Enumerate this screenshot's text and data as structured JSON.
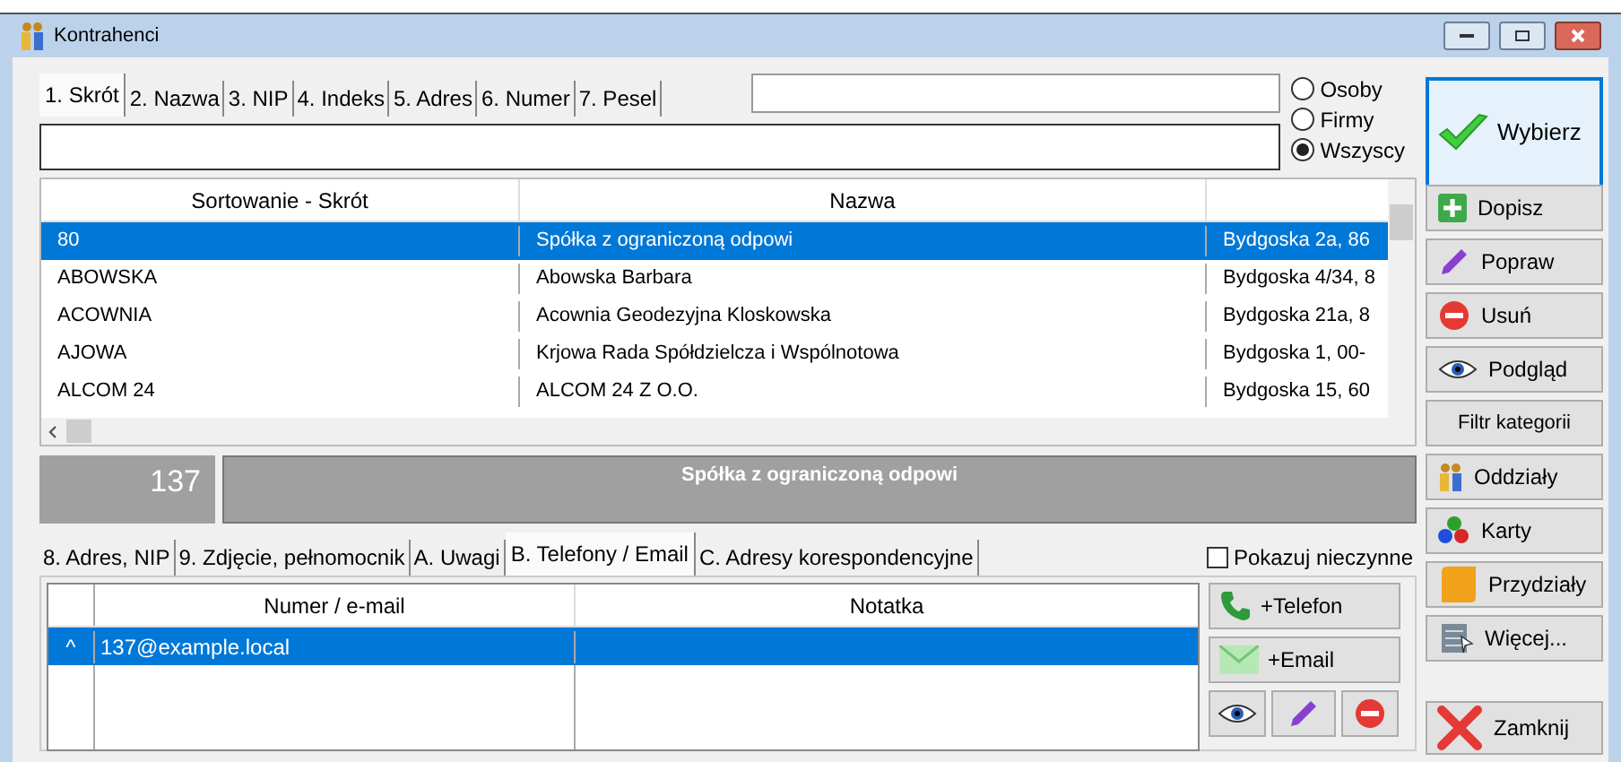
{
  "window": {
    "title": "Kontrahenci"
  },
  "search_tabs": [
    {
      "label": "1. Skrót",
      "selected": true
    },
    {
      "label": "2. Nazwa",
      "selected": false
    },
    {
      "label": "3. NIP",
      "selected": false
    },
    {
      "label": "4. Indeks",
      "selected": false
    },
    {
      "label": "5. Adres",
      "selected": false
    },
    {
      "label": "6. Numer",
      "selected": false
    },
    {
      "label": "7. Pesel",
      "selected": false
    }
  ],
  "filter": [
    {
      "label": "Osoby",
      "selected": false
    },
    {
      "label": "Firmy",
      "selected": false
    },
    {
      "label": "Wszyscy",
      "selected": true
    }
  ],
  "table": {
    "columns": [
      "Sortowanie - Skrót",
      "Nazwa"
    ],
    "rows": [
      {
        "cells": [
          "80",
          "Spółka z ograniczoną odpowi",
          "Bydgoska 2a, 86"
        ],
        "selected": true
      },
      {
        "cells": [
          "ABOWSKA",
          "Abowska Barbara",
          "Bydgoska 4/34, 8"
        ],
        "selected": false
      },
      {
        "cells": [
          "ACOWNIA",
          "Acownia Geodezyjna Kloskowska",
          "Bydgoska 21a, 8"
        ],
        "selected": false
      },
      {
        "cells": [
          "AJOWA",
          "Krjowa Rada Spółdzielcza i Wspólnotowa",
          "Bydgoska 1, 00-"
        ],
        "selected": false
      },
      {
        "cells": [
          "ALCOM 24",
          "ALCOM 24 Z O.O.",
          "Bydgoska 15, 60"
        ],
        "selected": false
      }
    ]
  },
  "details": {
    "number": "137",
    "name": "Spółka z ograniczoną odpowi"
  },
  "detail_tabs": [
    {
      "label": "8. Adres, NIP",
      "selected": false
    },
    {
      "label": "9. Zdjęcie, pełnomocnik",
      "selected": false
    },
    {
      "label": "A. Uwagi",
      "selected": false
    },
    {
      "label": "B. Telefony / Email",
      "selected": true
    },
    {
      "label": "C. Adresy korespondencyjne",
      "selected": false
    }
  ],
  "show_inactive": {
    "label": "Pokazuj nieczynne",
    "checked": false
  },
  "contacts": {
    "columns": [
      "Numer / e-mail",
      "Notatka"
    ],
    "rows": [
      {
        "marker": "^",
        "cells": [
          "137@example.local",
          ""
        ],
        "selected": true
      }
    ]
  },
  "contact_buttons": [
    {
      "kind": "phone",
      "label": "+Telefon"
    },
    {
      "kind": "email",
      "label": "+Email"
    }
  ],
  "side_buttons": [
    {
      "kind": "check",
      "label": "Wybierz"
    },
    {
      "kind": "plus",
      "label": "Dopisz"
    },
    {
      "kind": "pencil",
      "label": "Popraw"
    },
    {
      "kind": "minus",
      "label": "Usuń"
    },
    {
      "kind": "eye",
      "label": "Podgląd"
    },
    {
      "kind": "none",
      "label": "Filtr kategorii"
    },
    {
      "kind": "people",
      "label": "Oddziały"
    },
    {
      "kind": "balls",
      "label": "Karty"
    },
    {
      "kind": "doc",
      "label": "Przydziały"
    },
    {
      "kind": "more",
      "label": "Więcej..."
    },
    {
      "kind": "cross",
      "label": "Zamknij"
    }
  ]
}
